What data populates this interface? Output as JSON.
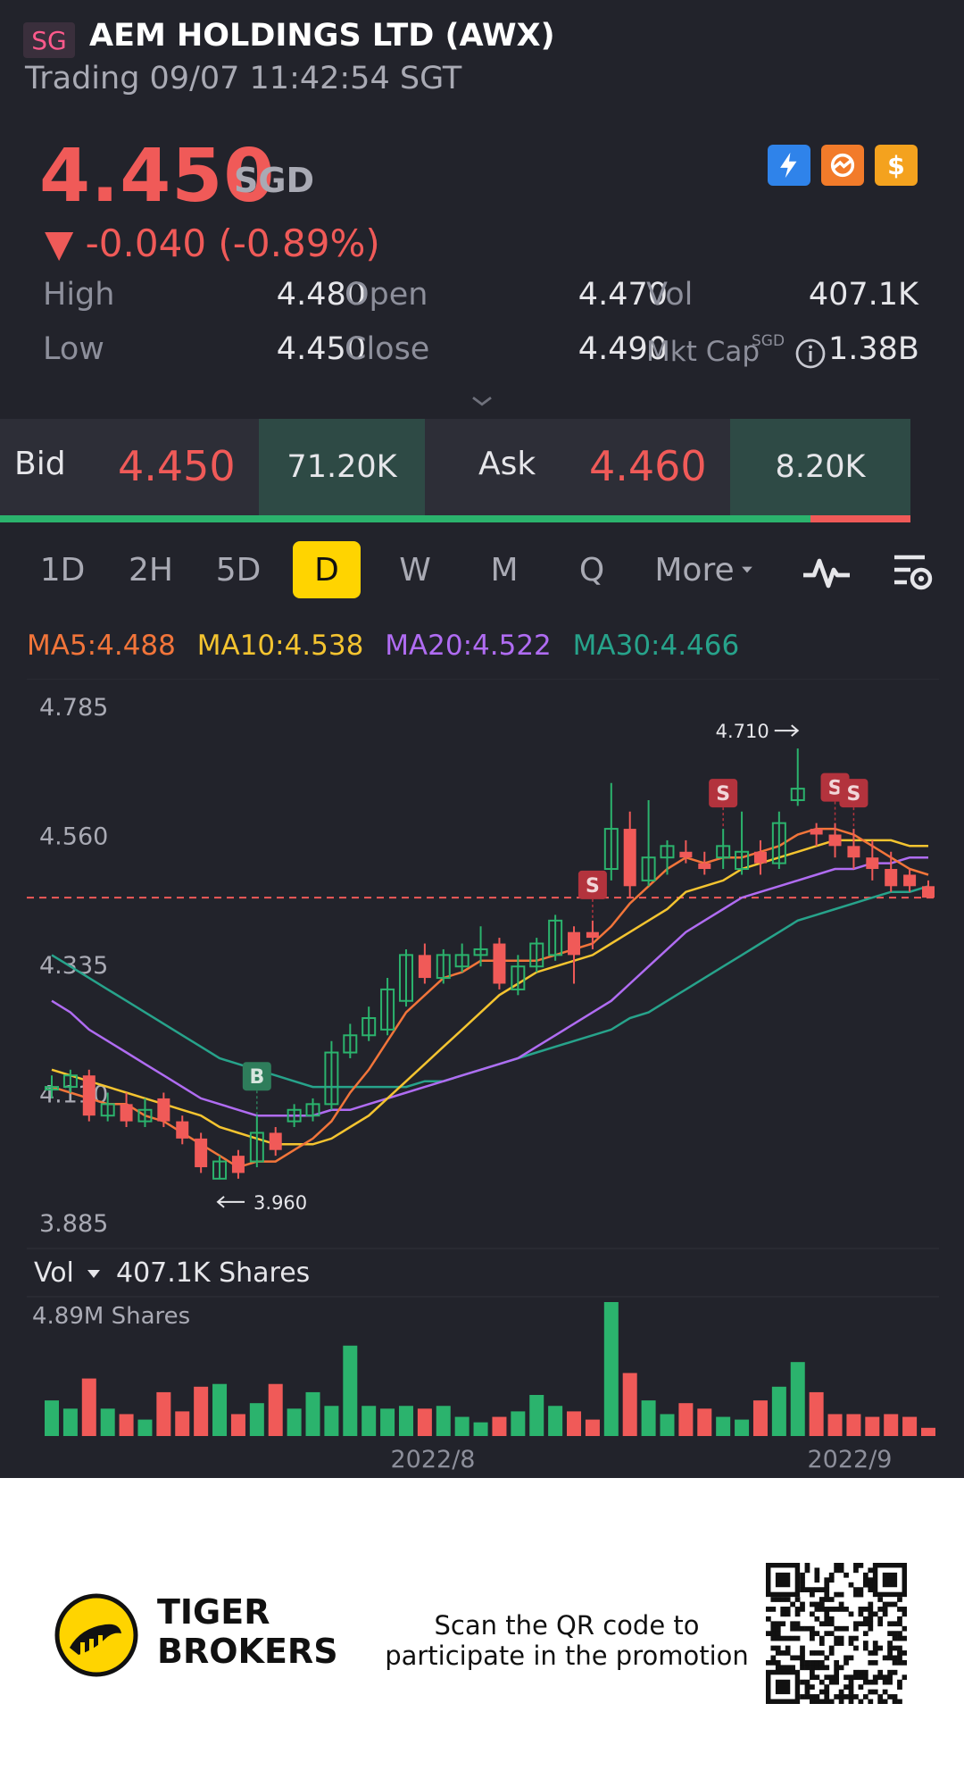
{
  "header": {
    "market_flag": "SG",
    "title": "AEM HOLDINGS LTD (AWX)",
    "status": "Trading 09/07 11:42:54 SGT"
  },
  "quote": {
    "price": "4.450",
    "currency": "SGD",
    "change": "▼ -0.040 (-0.89%)",
    "badges": [
      "lightning-icon",
      "pie-chart-icon",
      "dollar-icon"
    ]
  },
  "stats": {
    "high_label": "High",
    "high": "4.480",
    "open_label": "Open",
    "open": "4.470",
    "vol_label": "Vol",
    "vol": "407.1K",
    "low_label": "Low",
    "low": "4.450",
    "close_label": "Close",
    "close": "4.490",
    "mktcap_label": "Mkt Cap",
    "mktcap_sup": "SGD",
    "mktcap": "1.38B"
  },
  "bidask": {
    "bid_label": "Bid",
    "bid": "4.450",
    "bid_qty": "71.20K",
    "ask_label": "Ask",
    "ask": "4.460",
    "ask_qty": "8.20K"
  },
  "periods": {
    "items": [
      "1D",
      "2H",
      "5D",
      "D",
      "W",
      "M",
      "Q",
      "More"
    ],
    "active": "D"
  },
  "ma": {
    "ma5": "MA5:4.488",
    "ma10": "MA10:4.538",
    "ma20": "MA20:4.522",
    "ma30": "MA30:4.466"
  },
  "colors": {
    "up": "#2bb36d",
    "down": "#f05a58",
    "ma5": "#f2753a",
    "ma10": "#f4c430",
    "ma20": "#b06cf2",
    "ma30": "#27a38b"
  },
  "chart_data": {
    "type": "candlestick",
    "y_ticks": [
      "4.785",
      "4.560",
      "4.335",
      "4.110",
      "3.885"
    ],
    "ylim": [
      3.885,
      4.785
    ],
    "last_price": 4.45,
    "high_annotation": "4.710",
    "low_annotation": "3.960",
    "signals": [
      {
        "type": "B",
        "index": 11
      },
      {
        "type": "S",
        "index": 29
      },
      {
        "type": "S",
        "index": 36
      },
      {
        "type": "S",
        "index": 42
      },
      {
        "type": "S",
        "index": 43
      }
    ],
    "x_labels": [
      "2022/8",
      "2022/9"
    ],
    "candles": [
      [
        4.12,
        4.12,
        4.14,
        4.1
      ],
      [
        4.12,
        4.14,
        4.15,
        4.11
      ],
      [
        4.14,
        4.07,
        4.15,
        4.06
      ],
      [
        4.07,
        4.09,
        4.11,
        4.06
      ],
      [
        4.09,
        4.06,
        4.11,
        4.05
      ],
      [
        4.06,
        4.08,
        4.1,
        4.05
      ],
      [
        4.1,
        4.06,
        4.11,
        4.05
      ],
      [
        4.06,
        4.03,
        4.07,
        4.02
      ],
      [
        4.03,
        3.98,
        4.04,
        3.97
      ],
      [
        3.96,
        3.99,
        4.0,
        3.96
      ],
      [
        4.0,
        3.97,
        4.01,
        3.96
      ],
      [
        3.99,
        4.04,
        4.07,
        3.98
      ],
      [
        4.04,
        4.01,
        4.05,
        4.0
      ],
      [
        4.06,
        4.08,
        4.09,
        4.05
      ],
      [
        4.07,
        4.09,
        4.1,
        4.06
      ],
      [
        4.09,
        4.18,
        4.2,
        4.08
      ],
      [
        4.18,
        4.21,
        4.23,
        4.17
      ],
      [
        4.21,
        4.24,
        4.26,
        4.2
      ],
      [
        4.22,
        4.29,
        4.31,
        4.21
      ],
      [
        4.27,
        4.35,
        4.36,
        4.26
      ],
      [
        4.35,
        4.31,
        4.37,
        4.3
      ],
      [
        4.31,
        4.35,
        4.36,
        4.3
      ],
      [
        4.33,
        4.35,
        4.37,
        4.32
      ],
      [
        4.35,
        4.36,
        4.4,
        4.33
      ],
      [
        4.37,
        4.3,
        4.38,
        4.29
      ],
      [
        4.29,
        4.33,
        4.35,
        4.28
      ],
      [
        4.33,
        4.37,
        4.38,
        4.32
      ],
      [
        4.35,
        4.41,
        4.42,
        4.34
      ],
      [
        4.39,
        4.35,
        4.4,
        4.3
      ],
      [
        4.39,
        4.38,
        4.41,
        4.36
      ],
      [
        4.5,
        4.57,
        4.65,
        4.48
      ],
      [
        4.57,
        4.47,
        4.6,
        4.45
      ],
      [
        4.48,
        4.52,
        4.62,
        4.47
      ],
      [
        4.52,
        4.54,
        4.55,
        4.49
      ],
      [
        4.53,
        4.52,
        4.55,
        4.51
      ],
      [
        4.51,
        4.5,
        4.53,
        4.49
      ],
      [
        4.52,
        4.54,
        4.57,
        4.5
      ],
      [
        4.5,
        4.53,
        4.6,
        4.49
      ],
      [
        4.53,
        4.51,
        4.55,
        4.49
      ],
      [
        4.51,
        4.58,
        4.6,
        4.5
      ],
      [
        4.62,
        4.64,
        4.71,
        4.61
      ],
      [
        4.57,
        4.56,
        4.58,
        4.54
      ],
      [
        4.56,
        4.54,
        4.58,
        4.52
      ],
      [
        4.54,
        4.52,
        4.57,
        4.5
      ],
      [
        4.52,
        4.5,
        4.55,
        4.48
      ],
      [
        4.5,
        4.47,
        4.53,
        4.46
      ],
      [
        4.49,
        4.47,
        4.5,
        4.46
      ],
      [
        4.47,
        4.45,
        4.48,
        4.45
      ]
    ],
    "ma5": [
      4.12,
      4.11,
      4.1,
      4.09,
      4.09,
      4.07,
      4.06,
      4.04,
      4.02,
      4.0,
      3.98,
      3.99,
      3.99,
      4.01,
      4.03,
      4.06,
      4.11,
      4.15,
      4.2,
      4.25,
      4.28,
      4.31,
      4.32,
      4.34,
      4.34,
      4.34,
      4.34,
      4.35,
      4.36,
      4.37,
      4.4,
      4.44,
      4.47,
      4.5,
      4.52,
      4.51,
      4.52,
      4.52,
      4.53,
      4.54,
      4.56,
      4.57,
      4.57,
      4.56,
      4.54,
      4.52,
      4.5,
      4.49
    ],
    "ma10": [
      4.15,
      4.14,
      4.13,
      4.12,
      4.11,
      4.1,
      4.09,
      4.08,
      4.07,
      4.05,
      4.04,
      4.03,
      4.02,
      4.02,
      4.02,
      4.03,
      4.05,
      4.07,
      4.1,
      4.13,
      4.16,
      4.19,
      4.22,
      4.25,
      4.28,
      4.3,
      4.32,
      4.33,
      4.34,
      4.35,
      4.37,
      4.39,
      4.41,
      4.43,
      4.46,
      4.47,
      4.48,
      4.5,
      4.51,
      4.52,
      4.53,
      4.54,
      4.55,
      4.55,
      4.55,
      4.55,
      4.54,
      4.54
    ],
    "ma20": [
      4.27,
      4.25,
      4.22,
      4.2,
      4.18,
      4.16,
      4.14,
      4.12,
      4.1,
      4.09,
      4.08,
      4.07,
      4.07,
      4.07,
      4.07,
      4.08,
      4.08,
      4.09,
      4.1,
      4.11,
      4.12,
      4.13,
      4.14,
      4.15,
      4.16,
      4.17,
      4.19,
      4.21,
      4.23,
      4.25,
      4.27,
      4.3,
      4.33,
      4.36,
      4.39,
      4.41,
      4.43,
      4.45,
      4.46,
      4.47,
      4.48,
      4.49,
      4.5,
      4.5,
      4.51,
      4.51,
      4.52,
      4.52
    ],
    "ma30": [
      4.35,
      4.33,
      4.31,
      4.29,
      4.27,
      4.25,
      4.23,
      4.21,
      4.19,
      4.17,
      4.16,
      4.15,
      4.14,
      4.13,
      4.12,
      4.12,
      4.12,
      4.12,
      4.12,
      4.12,
      4.13,
      4.13,
      4.14,
      4.15,
      4.16,
      4.17,
      4.18,
      4.19,
      4.2,
      4.21,
      4.22,
      4.24,
      4.25,
      4.27,
      4.29,
      4.31,
      4.33,
      4.35,
      4.37,
      4.39,
      4.41,
      4.42,
      4.43,
      4.44,
      4.45,
      4.46,
      4.46,
      4.47
    ],
    "volume": {
      "label": "Vol",
      "current": "407.1K Shares",
      "max_label": "4.89M Shares",
      "max": 4.89,
      "values": [
        1.3,
        1.0,
        2.1,
        1.0,
        0.8,
        0.6,
        1.6,
        0.9,
        1.8,
        1.9,
        0.8,
        1.2,
        1.9,
        1.0,
        1.6,
        1.1,
        3.3,
        1.1,
        1.0,
        1.1,
        1.0,
        1.1,
        0.7,
        0.5,
        0.7,
        0.9,
        1.5,
        1.1,
        0.9,
        0.6,
        4.89,
        2.3,
        1.3,
        0.8,
        1.2,
        1.0,
        0.7,
        0.6,
        1.3,
        1.8,
        2.7,
        1.6,
        0.8,
        0.8,
        0.7,
        0.8,
        0.7,
        0.3
      ]
    }
  },
  "footer": {
    "brand_line1": "TIGER",
    "brand_line2": "BROKERS",
    "promo": "Scan the QR code to participate in the promotion"
  }
}
